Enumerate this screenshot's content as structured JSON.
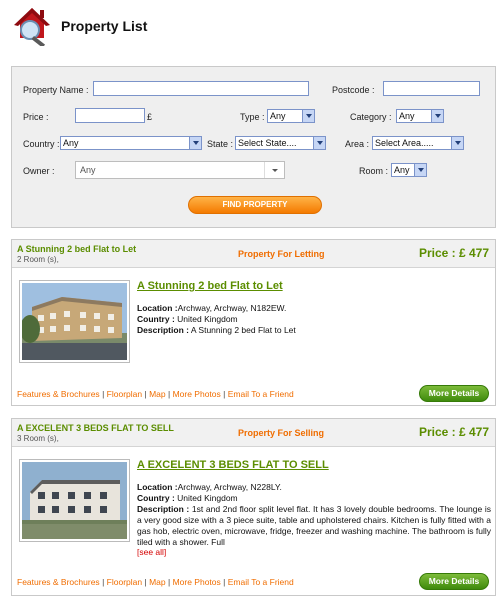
{
  "header": {
    "title": "Property List"
  },
  "search": {
    "property_name_label": "Property Name :",
    "property_name_value": "",
    "postcode_label": "Postcode :",
    "postcode_value": "",
    "price_label": "Price :",
    "price_value": "",
    "currency": "£",
    "type_label": "Type :",
    "type_value": "Any",
    "category_label": "Category :",
    "category_value": "Any",
    "country_label": "Country :",
    "country_value": "Any",
    "state_label": "State :",
    "state_value": "Select State....",
    "area_label": "Area :",
    "area_value": "Select Area.....",
    "owner_label": "Owner :",
    "owner_value": "Any",
    "room_label": "Room :",
    "room_value": "Any",
    "find_button": "FIND PROPERTY"
  },
  "listings": [
    {
      "title": "A Stunning 2 bed Flat to Let",
      "rooms": "2 Room (s),",
      "type": "Property For Letting",
      "price": "Price : £ 477",
      "link": "A Stunning 2 bed Flat to Let",
      "location_label": "Location :",
      "location": "Archway, Archway, N182EW.",
      "country_label": "Country :",
      "country": "United Kingdom",
      "description_label": "Description :",
      "description": "A Stunning 2 bed Flat to Let",
      "see_all": "",
      "more_details": "More Details"
    },
    {
      "title": "A EXCELENT 3 BEDS FLAT TO SELL",
      "rooms": "3 Room (s),",
      "type": "Property For Selling",
      "price": "Price : £ 477",
      "link": "A EXCELENT 3 BEDS FLAT TO SELL",
      "location_label": "Location :",
      "location": "Archway, Archway, N228LY.",
      "country_label": "Country :",
      "country": "United Kingdom",
      "description_label": "Description :",
      "description": "1st and 2nd floor split level flat. It has 3 lovely double bedrooms. The lounge is a very good size with a 3 piece suite, table and upholstered chairs. Kitchen is fully fitted with a gas hob, electric oven, microwave, fridge, freezer and washing machine. The bathroom is fully tiled with a shower. Full",
      "see_all": "[see all]",
      "more_details": "More Details"
    }
  ],
  "footer_links": {
    "features": "Features & Brochures",
    "floorplan": "Floorplan",
    "map": "Map",
    "photos": "More Photos",
    "email": "Email To a Friend",
    "separator": "|"
  },
  "colors": {
    "accent_green": "#5b8d00",
    "accent_orange": "#f06d00"
  }
}
